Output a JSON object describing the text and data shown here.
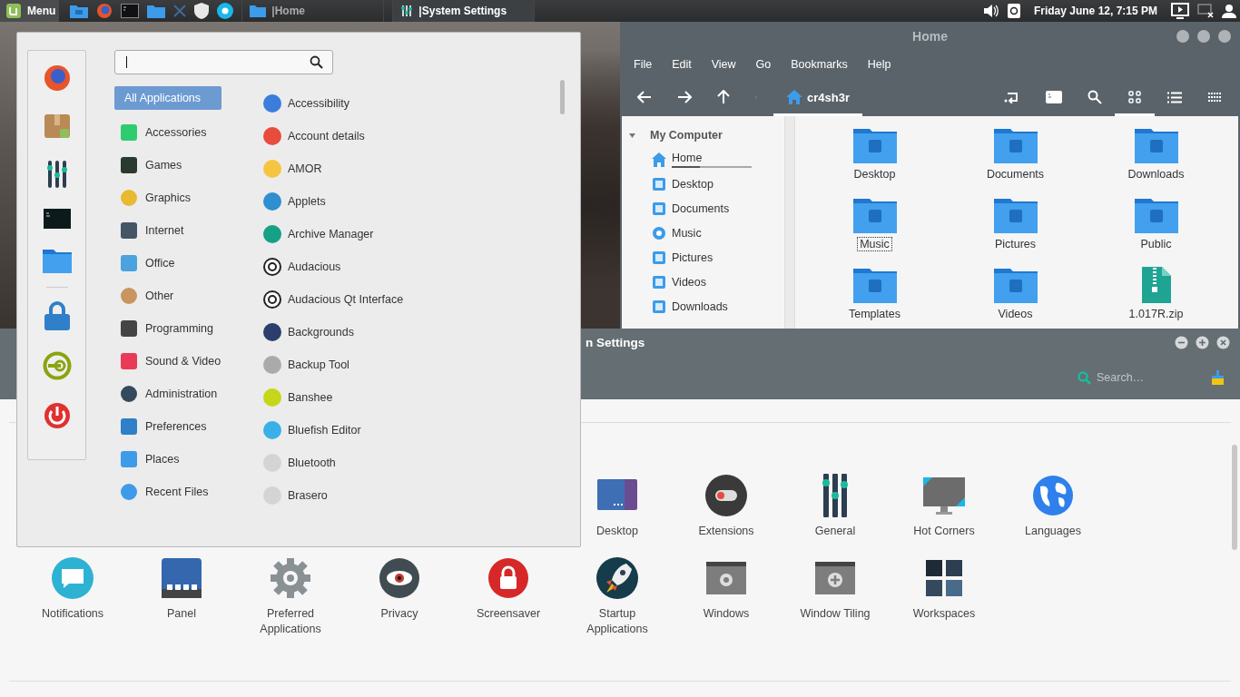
{
  "panel": {
    "menu_label": "Menu",
    "windows": [
      {
        "title": "|Home",
        "selected": false
      },
      {
        "title": "|System Settings",
        "selected": true
      }
    ],
    "clock": "Friday June 12,  7:15 PM"
  },
  "menu": {
    "categories": [
      {
        "label": "All Applications",
        "selected": true
      },
      {
        "label": "Accessories",
        "selected": false
      },
      {
        "label": "Games",
        "selected": false
      },
      {
        "label": "Graphics",
        "selected": false
      },
      {
        "label": "Internet",
        "selected": false
      },
      {
        "label": "Office",
        "selected": false
      },
      {
        "label": "Other",
        "selected": false
      },
      {
        "label": "Programming",
        "selected": false
      },
      {
        "label": "Sound & Video",
        "selected": false
      },
      {
        "label": "Administration",
        "selected": false
      },
      {
        "label": "Preferences",
        "selected": false
      },
      {
        "label": "Places",
        "selected": false
      },
      {
        "label": "Recent Files",
        "selected": false
      }
    ],
    "applications": [
      "Accessibility",
      "Account details",
      "AMOR",
      "Applets",
      "Archive Manager",
      "Audacious",
      "Audacious Qt Interface",
      "Backgrounds",
      "Backup Tool",
      "Banshee",
      "Bluefish Editor",
      "Bluetooth",
      "Brasero"
    ]
  },
  "file_manager": {
    "title": "Home",
    "menu": [
      "File",
      "Edit",
      "View",
      "Go",
      "Bookmarks",
      "Help"
    ],
    "path": "cr4sh3r",
    "views": [
      {
        "selected": true
      },
      {
        "selected": false
      },
      {
        "selected": false
      }
    ],
    "sidebar": {
      "heading": "My Computer",
      "expanded": true,
      "items": [
        {
          "label": "Home",
          "level": 0.35
        },
        {
          "label": "Desktop"
        },
        {
          "label": "Documents"
        },
        {
          "label": "Music"
        },
        {
          "label": "Pictures"
        },
        {
          "label": "Videos"
        },
        {
          "label": "Downloads"
        }
      ]
    },
    "files": [
      {
        "name": "Desktop",
        "kind": "folder",
        "focused": false
      },
      {
        "name": "Documents",
        "kind": "folder",
        "focused": false
      },
      {
        "name": "Downloads",
        "kind": "folder",
        "focused": false
      },
      {
        "name": "Music",
        "kind": "folder",
        "focused": true
      },
      {
        "name": "Pictures",
        "kind": "folder",
        "focused": false
      },
      {
        "name": "Public",
        "kind": "folder",
        "focused": false
      },
      {
        "name": "Templates",
        "kind": "folder",
        "focused": false
      },
      {
        "name": "Videos",
        "kind": "folder",
        "focused": false
      },
      {
        "name": "1.017R.zip",
        "kind": "archive",
        "focused": false
      }
    ]
  },
  "settings": {
    "title": "n Settings",
    "search": {
      "placeholder": "Search…"
    },
    "rows": [
      [
        "",
        "",
        "",
        "",
        "",
        "Desktop",
        "Extensions",
        "General",
        "Hot Corners",
        "Languages"
      ],
      [
        "Notifications",
        "Panel",
        "Preferred Applications",
        "Privacy",
        "Screensaver",
        "Startup Applications",
        "Windows",
        "Window Tiling",
        "Workspaces"
      ]
    ]
  }
}
